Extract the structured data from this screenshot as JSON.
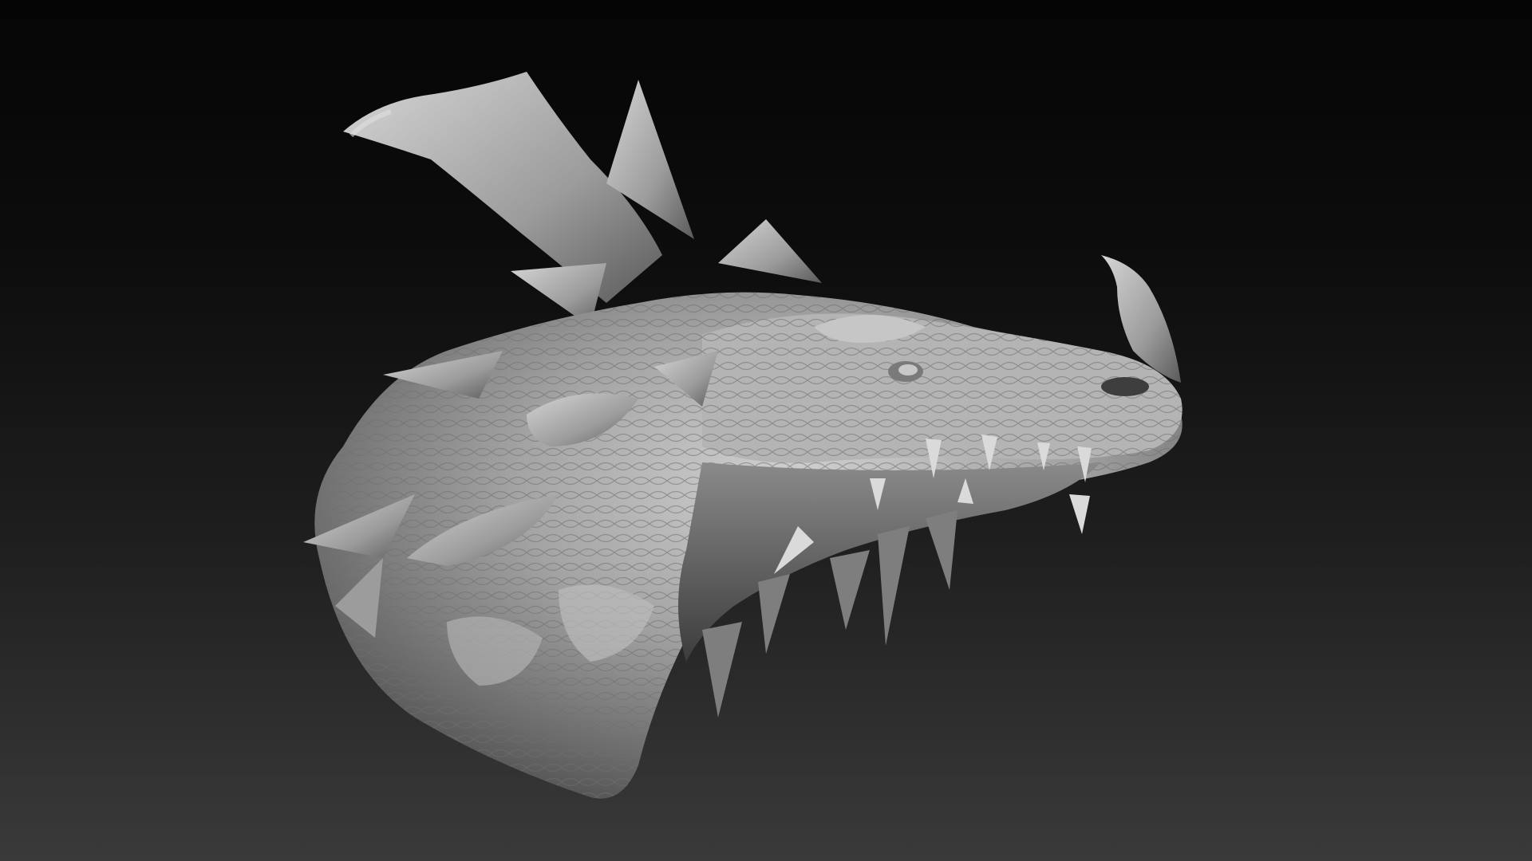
{
  "scene": {
    "subject": "dragon-head-sculpt",
    "background_top": "#050505",
    "background_bottom": "#3a3a3a",
    "material_base": "#9a9a9a",
    "material_highlight": "#d0d0d0",
    "material_shadow": "#4a4a4a"
  }
}
